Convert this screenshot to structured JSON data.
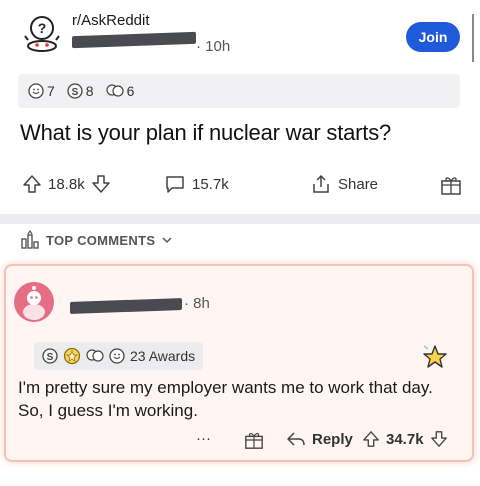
{
  "post": {
    "subreddit": "r/AskReddit",
    "time": "· 10h",
    "join_label": "Join",
    "awards": [
      {
        "icon": "wholesome-award-icon",
        "count": "7"
      },
      {
        "icon": "silver-award-icon",
        "count": "8"
      },
      {
        "icon": "hugz-award-icon",
        "count": "6"
      }
    ],
    "title": "What is your plan if nuclear war starts?",
    "upvotes": "18.8k",
    "comments": "15.7k",
    "share_label": "Share"
  },
  "section": {
    "top_comments_label": "TOP COMMENTS"
  },
  "comment": {
    "time": "· 8h",
    "awards_label": "23 Awards",
    "body": "I'm pretty sure my employer wants me to work that day. So, I guess I'm working.",
    "more_label": "···",
    "reply_label": "Reply",
    "upvotes": "34.7k"
  },
  "colors": {
    "join_button": "#1f5bd8",
    "comment_highlight": "#f5c2b8",
    "avatar": "#e56d84"
  }
}
